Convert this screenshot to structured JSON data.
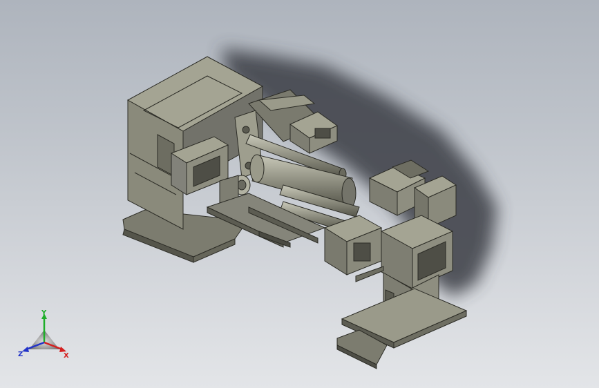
{
  "triad": {
    "x_label": "X",
    "y_label": "Y",
    "z_label": "Z",
    "colors": {
      "x": "#d42020",
      "y": "#1fae2a",
      "z": "#2233c8"
    }
  },
  "colors": {
    "background_top": "#aeb4bd",
    "background_bottom": "#e3e5e8",
    "machine_face": "#8f8f80",
    "machine_light": "#a6a695",
    "machine_dark": "#5e5e52",
    "shadow": "#3a3d44"
  }
}
